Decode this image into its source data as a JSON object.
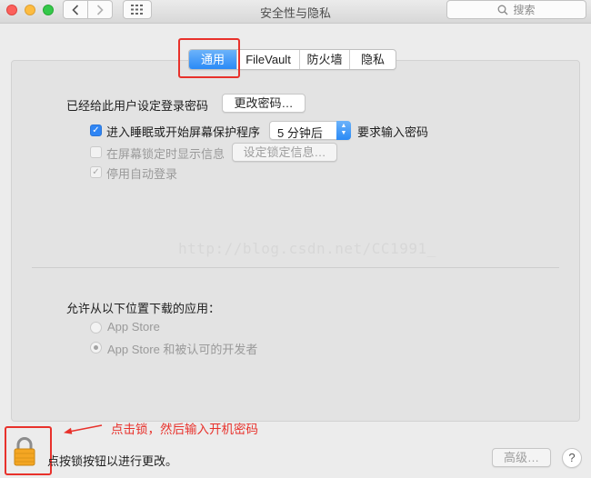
{
  "window": {
    "title": "安全性与隐私",
    "search_placeholder": "搜索"
  },
  "tabs": [
    {
      "label": "通用",
      "active": true
    },
    {
      "label": "FileVault",
      "active": false
    },
    {
      "label": "防火墙",
      "active": false
    },
    {
      "label": "隐私",
      "active": false
    }
  ],
  "general": {
    "password_label": "已经给此用户设定登录密码",
    "change_password_button": "更改密码…",
    "require_password": {
      "checked": true,
      "label": "进入睡眠或开始屏幕保护程序",
      "delay_value": "5 分钟后",
      "suffix": "要求输入密码"
    },
    "lock_message": {
      "checked": false,
      "enabled": false,
      "label": "在屏幕锁定时显示信息",
      "button": "设定锁定信息…"
    },
    "disable_auto_login": {
      "checked": true,
      "enabled": false,
      "label": "停用自动登录"
    }
  },
  "watermark": "http://blog.csdn.net/CC1991_",
  "downloads": {
    "heading": "允许从以下位置下载的应用：",
    "options": [
      {
        "label": "App Store",
        "selected": false
      },
      {
        "label": "App Store 和被认可的开发者",
        "selected": true
      }
    ]
  },
  "footer": {
    "lock_text": "点按锁按钮以进行更改。",
    "advanced_button": "高级…",
    "help_button": "?"
  },
  "annotation": {
    "text": "点击锁，然后输入开机密码",
    "color": "#e8312b"
  },
  "colors": {
    "accent": "#2a8af6",
    "window_bg": "#ececec"
  }
}
